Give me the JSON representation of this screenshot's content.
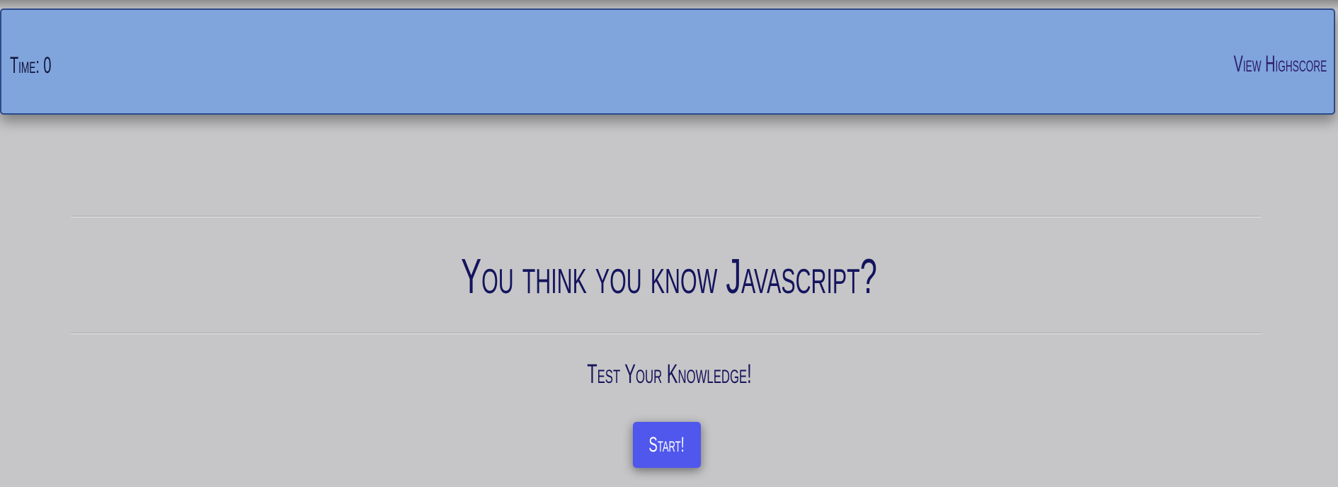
{
  "header": {
    "timer_label": "Time: 0",
    "highscore_link": "View Highscore"
  },
  "main": {
    "title": "You think you know Javascript?",
    "subtitle": "Test Your Knowledge!",
    "start_button": "Start!"
  },
  "colors": {
    "background": "#c6c6c8",
    "header_bg": "#80a5dc",
    "header_border": "#2c4a8a",
    "text": "#15145a",
    "button_bg": "#4f57ec",
    "button_text": "#ffffff"
  }
}
